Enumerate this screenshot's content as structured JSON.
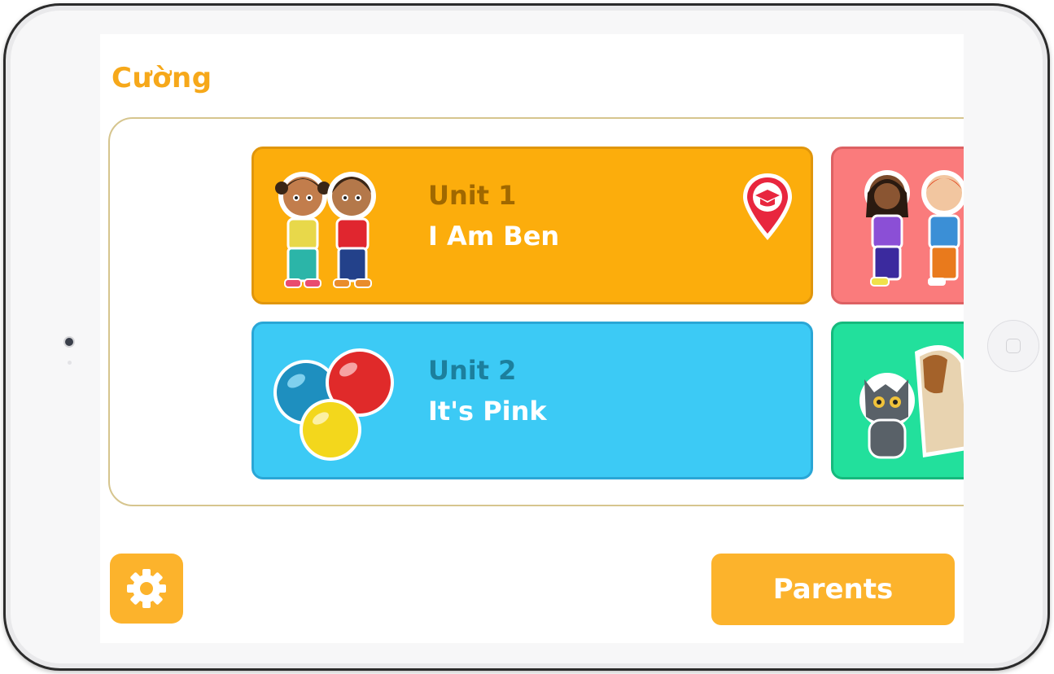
{
  "profile": {
    "name": "Cường"
  },
  "units": [
    {
      "number_label": "Unit 1",
      "title": "I Am Ben",
      "color": "#fcad0c",
      "thumbnail": "two-kids-illustration",
      "badge": "graduation-cap-map-pin-icon"
    },
    {
      "number_label": "Unit 2",
      "title": "It's Pink",
      "color": "#3ccaf5",
      "thumbnail": "colored-balls-illustration"
    }
  ],
  "partial_cards": [
    {
      "color": "#fa7b7c",
      "thumbnail": "two-kids-waving-illustration"
    },
    {
      "color": "#22e09c",
      "thumbnail": "cat-and-dog-illustration"
    }
  ],
  "footer": {
    "settings_icon": "gear-icon",
    "parents_label": "Parents"
  },
  "colors": {
    "accent": "#f6a81a",
    "button": "#fcb32c",
    "panel_border": "#d6c58e"
  }
}
